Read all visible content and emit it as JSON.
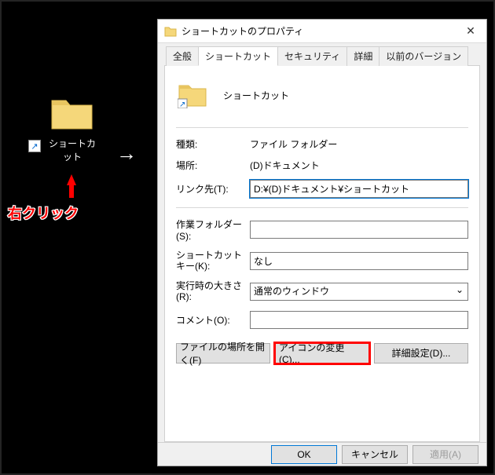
{
  "desktop": {
    "icon_label": "ショートカット",
    "right_click_text": "右クリック"
  },
  "dialog": {
    "title": "ショートカットのプロパティ",
    "close": "✕"
  },
  "tabs": {
    "general": "全般",
    "shortcut": "ショートカット",
    "security": "セキュリティ",
    "details": "詳細",
    "previous": "以前のバージョン"
  },
  "header": {
    "name": "ショートカット"
  },
  "fields": {
    "type_label": "種類:",
    "type_value": "ファイル フォルダー",
    "location_label": "場所:",
    "location_value": "(D)ドキュメント",
    "target_label": "リンク先(T):",
    "target_value": "D:¥(D)ドキュメント¥ショートカット",
    "workdir_label": "作業フォルダー(S):",
    "workdir_value": "",
    "key_label": "ショートカット キー(K):",
    "key_value": "なし",
    "run_label": "実行時の大きさ(R):",
    "run_value": "通常のウィンドウ",
    "comment_label": "コメント(O):",
    "comment_value": ""
  },
  "buttons": {
    "open_location": "ファイルの場所を開く(F)",
    "change_icon": "アイコンの変更(C)...",
    "advanced": "詳細設定(D)..."
  },
  "footer": {
    "ok": "OK",
    "cancel": "キャンセル",
    "apply": "適用(A)"
  }
}
